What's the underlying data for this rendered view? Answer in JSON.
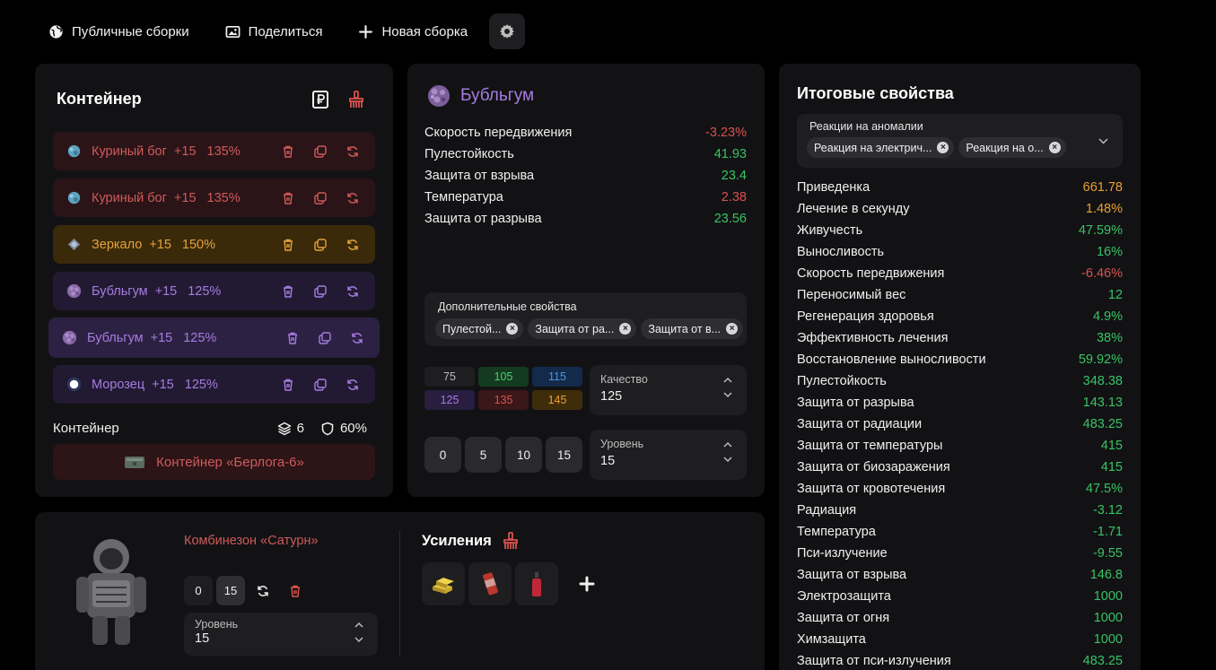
{
  "topbar": {
    "public_builds": "Публичные сборки",
    "share": "Поделиться",
    "new_build": "Новая сборка"
  },
  "container_panel": {
    "title": "Контейнер",
    "artifacts": [
      {
        "name": "Куриный бог",
        "level": "+15",
        "quality": "135%",
        "color": "red"
      },
      {
        "name": "Куриный бог",
        "level": "+15",
        "quality": "135%",
        "color": "red"
      },
      {
        "name": "Зеркало",
        "level": "+15",
        "quality": "150%",
        "color": "orange"
      },
      {
        "name": "Бубльгум",
        "level": "+15",
        "quality": "125%",
        "color": "purple"
      },
      {
        "name": "Бубльгум",
        "level": "+15",
        "quality": "125%",
        "color": "purple",
        "selected": true
      },
      {
        "name": "Морозец",
        "level": "+15",
        "quality": "125%",
        "color": "purple"
      }
    ],
    "footer_label": "Контейнер",
    "slots": "6",
    "protection": "60%",
    "container_button": "Контейнер «Берлога-6»"
  },
  "detail_panel": {
    "artifact_name": "Бубльгум",
    "properties": [
      {
        "label": "Скорость передвижения",
        "value": "-3.23%",
        "tone": "neg"
      },
      {
        "label": "Пулестойкость",
        "value": "41.93",
        "tone": "pos"
      },
      {
        "label": "Защита от взрыва",
        "value": "23.4",
        "tone": "pos"
      },
      {
        "label": "Температура",
        "value": "2.38",
        "tone": "neg"
      },
      {
        "label": "Защита от разрыва",
        "value": "23.56",
        "tone": "pos"
      }
    ],
    "extra_label": "Дополнительные свойства",
    "extra_chips": [
      "Пулестой...",
      "Защита от ра...",
      "Защита от в..."
    ],
    "quality_grid": [
      "75",
      "105",
      "115",
      "125",
      "135",
      "145"
    ],
    "quality_label": "Качество",
    "quality_value": "125",
    "level_buttons": [
      "0",
      "5",
      "10",
      "15"
    ],
    "level_label": "Уровень",
    "level_value": "15"
  },
  "summary_panel": {
    "title": "Итоговые свойства",
    "filter_label": "Реакции на аномалии",
    "filter_chips": [
      "Реакция на электрич...",
      "Реакция на о..."
    ],
    "properties": [
      {
        "label": "Приведенка",
        "value": "661.78",
        "tone": "gold"
      },
      {
        "label": "Лечение в секунду",
        "value": "1.48%",
        "tone": "gold"
      },
      {
        "label": "Живучесть",
        "value": "47.59%",
        "tone": "pos"
      },
      {
        "label": "Выносливость",
        "value": "16%",
        "tone": "pos"
      },
      {
        "label": "Скорость передвижения",
        "value": "-6.46%",
        "tone": "neg"
      },
      {
        "label": "Переносимый вес",
        "value": "12",
        "tone": "pos"
      },
      {
        "label": "Регенерация здоровья",
        "value": "4.9%",
        "tone": "pos"
      },
      {
        "label": "Эффективность лечения",
        "value": "38%",
        "tone": "pos"
      },
      {
        "label": "Восстановление выносливости",
        "value": "59.92%",
        "tone": "pos"
      },
      {
        "label": "Пулестойкость",
        "value": "348.38",
        "tone": "pos"
      },
      {
        "label": "Защита от разрыва",
        "value": "143.13",
        "tone": "pos"
      },
      {
        "label": "Защита от радиации",
        "value": "483.25",
        "tone": "pos"
      },
      {
        "label": "Защита от температуры",
        "value": "415",
        "tone": "pos"
      },
      {
        "label": "Защита от биозаражения",
        "value": "415",
        "tone": "pos"
      },
      {
        "label": "Защита от кровотечения",
        "value": "47.5%",
        "tone": "pos"
      },
      {
        "label": "Радиация",
        "value": "-3.12",
        "tone": "pos"
      },
      {
        "label": "Температура",
        "value": "-1.71",
        "tone": "pos"
      },
      {
        "label": "Пси-излучение",
        "value": "-9.55",
        "tone": "pos"
      },
      {
        "label": "Защита от взрыва",
        "value": "146.8",
        "tone": "pos"
      },
      {
        "label": "Электрозащита",
        "value": "1000",
        "tone": "pos"
      },
      {
        "label": "Защита от огня",
        "value": "1000",
        "tone": "pos"
      },
      {
        "label": "Химзащита",
        "value": "1000",
        "tone": "pos"
      },
      {
        "label": "Защита от пси-излучения",
        "value": "483.25",
        "tone": "pos"
      }
    ]
  },
  "armor_panel": {
    "name": "Комбинезон «Сатурн»",
    "buttons": [
      "0",
      "15"
    ],
    "level_label": "Уровень",
    "level_value": "15",
    "upgrades_title": "Усиления"
  }
}
